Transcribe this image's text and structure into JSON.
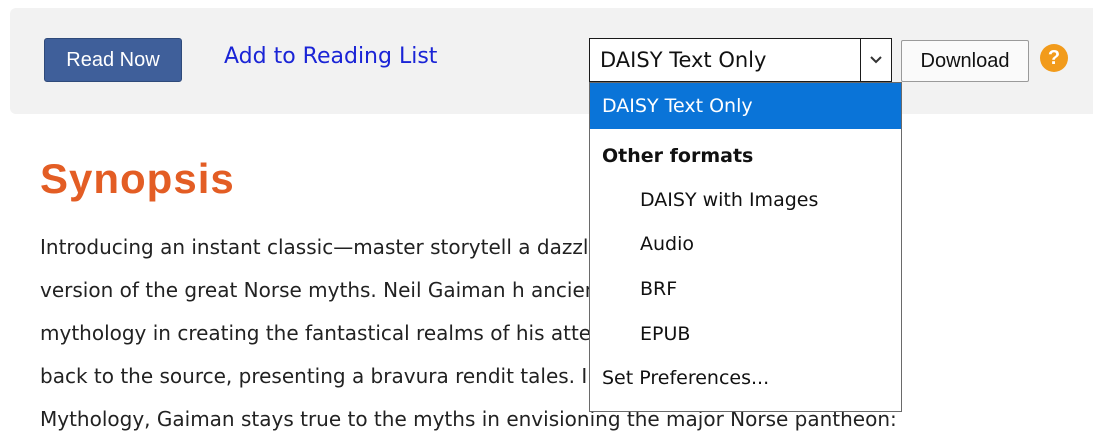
{
  "actions": {
    "read_now": "Read Now",
    "add_to_list": "Add to Reading List",
    "format_selected": "DAISY Text Only",
    "download": "Download",
    "help": "?"
  },
  "dropdown": {
    "selected": "DAISY Text Only",
    "group_label": "Other formats",
    "options": [
      "DAISY with Images",
      "Audio",
      "BRF",
      "EPUB"
    ],
    "preferences": "Set Preferences..."
  },
  "synopsis": {
    "title": "Synopsis",
    "lines": [
      "Introducing an instant classic—master storytell                                  a dazzling",
      "version of the great Norse myths. Neil Gaiman h                                  ancient",
      "mythology in creating the fantastical realms of                                  his attention",
      "back to the source, presenting a bravura rendit                                  tales. In Norse",
      "Mythology, Gaiman stays true to the myths in envisioning the major Norse pantheon:"
    ]
  },
  "colors": {
    "read_now_bg": "#3f5f9a",
    "link": "#1a24d6",
    "title": "#e35d24",
    "selected_option_bg": "#0a74d8",
    "help_icon": "#f29b1b"
  }
}
